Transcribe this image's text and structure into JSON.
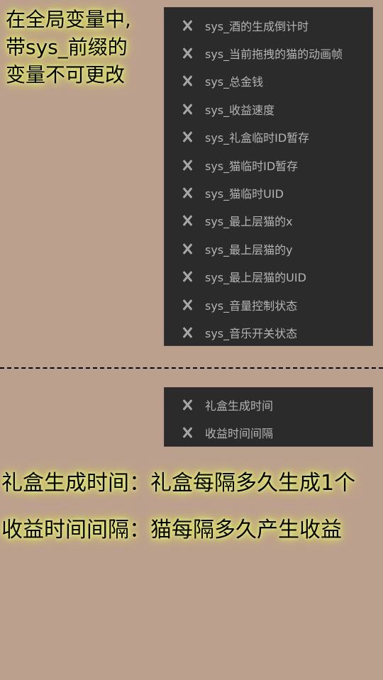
{
  "note_top": {
    "line1": "在全局变量中,",
    "line2": "带sys_前缀的",
    "line3": "变量不可更改"
  },
  "sys_variables": [
    {
      "label": "sys_酒的生成倒计时",
      "icon": "x-delete-icon"
    },
    {
      "label": "sys_当前拖拽的猫的动画帧",
      "icon": "x-delete-icon"
    },
    {
      "label": "sys_总金钱",
      "icon": "x-delete-icon"
    },
    {
      "label": "sys_收益速度",
      "icon": "x-delete-icon"
    },
    {
      "label": "sys_礼盒临时ID暂存",
      "icon": "x-delete-icon"
    },
    {
      "label": "sys_猫临时ID暂存",
      "icon": "x-delete-icon"
    },
    {
      "label": "sys_猫临时UID",
      "icon": "x-delete-icon"
    },
    {
      "label": "sys_最上层猫的x",
      "icon": "x-delete-icon"
    },
    {
      "label": "sys_最上层猫的y",
      "icon": "x-delete-icon"
    },
    {
      "label": "sys_最上层猫的UID",
      "icon": "x-delete-icon"
    },
    {
      "label": "sys_音量控制状态",
      "icon": "x-delete-icon"
    },
    {
      "label": "sys_音乐开关状态",
      "icon": "x-delete-icon"
    }
  ],
  "new_variables": [
    {
      "label": "礼盒生成时间",
      "icon": "x-delete-icon"
    },
    {
      "label": "收益时间间隔",
      "icon": "x-delete-icon"
    }
  ],
  "descriptions": {
    "gift_time": "礼盒生成时间：礼盒每隔多久生成1个",
    "income_interval": "收益时间间隔：猫每隔多久产生收益"
  },
  "colors": {
    "background": "#bca08e",
    "panel": "#2b2b2b",
    "label_text": "#b4b4b4",
    "glow": "#e8ec7a"
  }
}
